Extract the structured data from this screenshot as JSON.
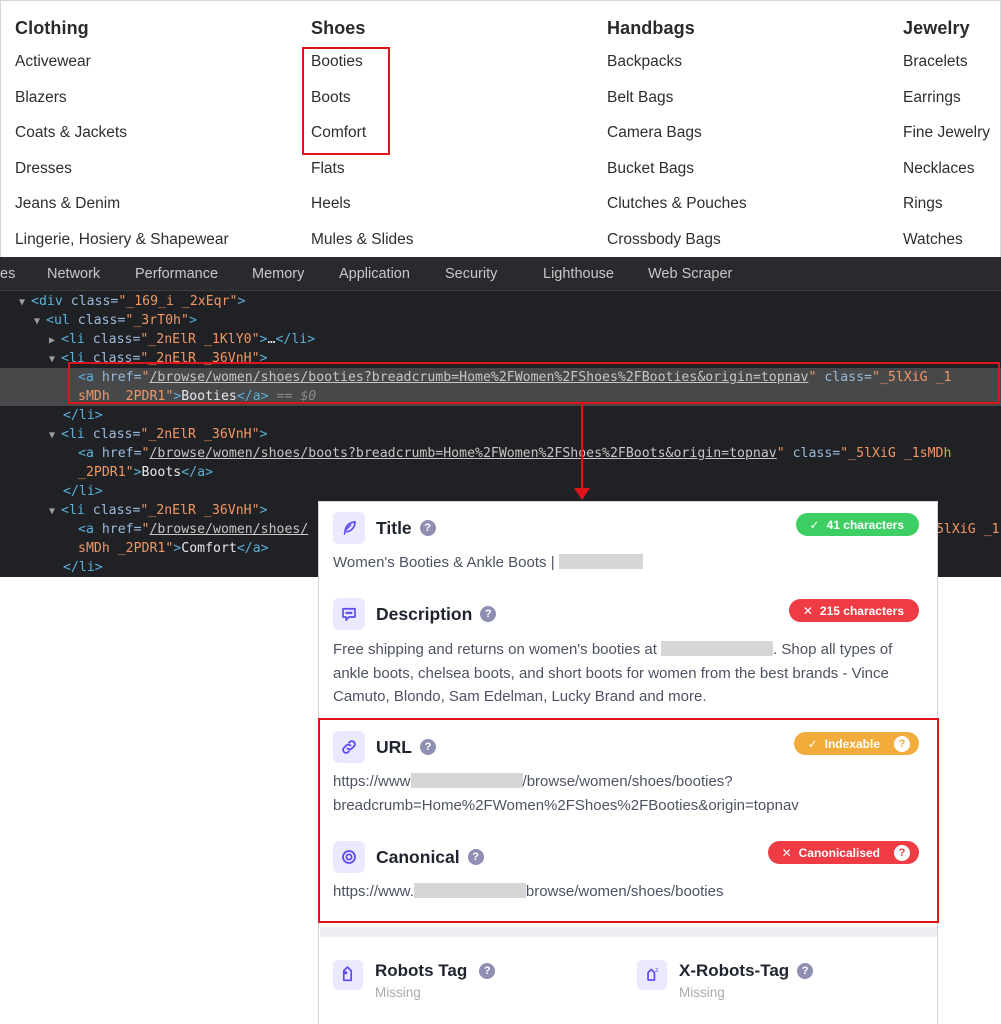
{
  "nav_menu": {
    "columns": [
      {
        "heading": "Clothing",
        "items": [
          "Activewear",
          "Blazers",
          "Coats & Jackets",
          "Dresses",
          "Jeans & Denim",
          "Lingerie, Hosiery & Shapewear"
        ]
      },
      {
        "heading": "Shoes",
        "items": [
          "Booties",
          "Boots",
          "Comfort",
          "Flats",
          "Heels",
          "Mules & Slides"
        ]
      },
      {
        "heading": "Handbags",
        "items": [
          "Backpacks",
          "Belt Bags",
          "Camera Bags",
          "Bucket Bags",
          "Clutches & Pouches",
          "Crossbody Bags"
        ]
      },
      {
        "heading": "Jewelry",
        "items": [
          "Bracelets",
          "Earrings",
          "Fine Jewelry",
          "Necklaces",
          "Rings",
          "Watches"
        ]
      }
    ]
  },
  "devtools": {
    "tabs": [
      "es",
      "Network",
      "Performance",
      "Memory",
      "Application",
      "Security",
      "Lighthouse",
      "Web Scraper"
    ],
    "code": {
      "div_class": "_169_i _2xEqr",
      "ul_class": "_3rT0h",
      "li_collapsed_class": "_2nElR _1KlY0",
      "li_class": "_2nElR _36VnH",
      "booties_href": "/browse/women/shoes/booties?breadcrumb=Home%2FWomen%2FShoes%2FBooties&origin=topnav",
      "booties_class_part1": "_5lXiG _1",
      "booties_class_part2": "sMDh _2PDR1",
      "booties_text": "Booties",
      "selected_marker": "== $0",
      "boots_href": "/browse/women/shoes/boots?breadcrumb=Home%2FWomen%2FShoes%2FBoots&origin=topnav",
      "boots_class_part1": "_5lXiG _1sMDh",
      "boots_class_part2": "_2PDR1",
      "boots_text": "Boots",
      "comfort_href_visible": "/browse/women/shoes/",
      "comfort_class_part1": "_5lXiG _1",
      "comfort_class_part2": "sMDh _2PDR1",
      "comfort_text": "Comfort",
      "ellipsis": "…"
    }
  },
  "seo_panel": {
    "title": {
      "label": "Title",
      "badge": "41 characters",
      "badge_status": "pass",
      "value": "Women's Booties & Ankle Boots |"
    },
    "description": {
      "label": "Description",
      "badge": "215 characters",
      "badge_status": "fail",
      "value_part1": "Free shipping and returns on women's booties at",
      "value_part2": ". Shop all types of ankle boots, chelsea boots, and short boots for women from the best brands - Vince Camuto, Blondo, Sam Edelman, Lucky Brand and more."
    },
    "url": {
      "label": "URL",
      "badge": "Indexable",
      "badge_status": "warning",
      "value_prefix": "https://www",
      "value_suffix": "/browse/women/shoes/booties?",
      "value_line2": "breadcrumb=Home%2FWomen%2FShoes%2FBooties&origin=topnav"
    },
    "canonical": {
      "label": "Canonical",
      "badge": "Canonicalised",
      "badge_status": "fail",
      "value_prefix": "https://www.",
      "value_suffix": "browse/women/shoes/booties"
    },
    "robots_tag": {
      "label": "Robots Tag",
      "value": "Missing"
    },
    "x_robots_tag": {
      "label": "X-Robots-Tag",
      "value": "Missing"
    },
    "help_glyph": "?",
    "check_glyph": "✓",
    "cross_glyph": "✕"
  },
  "colors": {
    "highlight_red": "#e0131b",
    "badge_green": "#3ecf64",
    "badge_red": "#ef3b44",
    "badge_orange": "#f2ac3c",
    "icon_purple": "#5b4cf0",
    "icon_bg": "#ebe9fe"
  }
}
